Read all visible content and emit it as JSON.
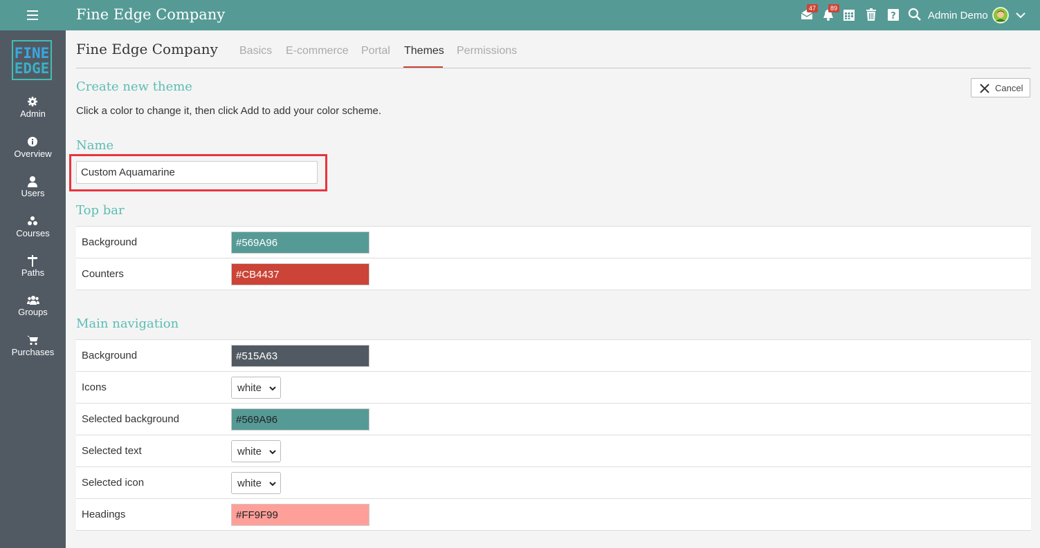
{
  "topbar": {
    "brand": "Fine Edge Company",
    "messages_count": "47",
    "notifications_count": "89",
    "user_name": "Admin Demo"
  },
  "sidebar": {
    "logo_line1": "FINE",
    "logo_line2": "EDGE",
    "items": [
      {
        "label": "Admin",
        "icon": "gear-icon"
      },
      {
        "label": "Overview",
        "icon": "info-icon"
      },
      {
        "label": "Users",
        "icon": "user-icon"
      },
      {
        "label": "Courses",
        "icon": "courses-icon"
      },
      {
        "label": "Paths",
        "icon": "signpost-icon"
      },
      {
        "label": "Groups",
        "icon": "group-icon"
      },
      {
        "label": "Purchases",
        "icon": "cart-icon"
      }
    ]
  },
  "header": {
    "title": "Fine Edge Company",
    "tabs": [
      "Basics",
      "E-commerce",
      "Portal",
      "Themes",
      "Permissions"
    ],
    "active_tab": "Themes"
  },
  "theme_form": {
    "heading": "Create new theme",
    "description": "Click a color to change it, then click Add to add your color scheme.",
    "cancel_label": "Cancel",
    "name_label": "Name",
    "name_value": "Custom Aquamarine",
    "top_bar_heading": "Top bar",
    "top_bar_rows": [
      {
        "label": "Background",
        "value": "#569A96",
        "color": "#569A96"
      },
      {
        "label": "Counters",
        "value": "#CB4437",
        "color": "#CB4437"
      }
    ],
    "main_nav_heading": "Main navigation",
    "main_nav_rows": [
      {
        "label": "Background",
        "value": "#515A63",
        "color": "#515A63"
      },
      {
        "label": "Icons",
        "value": "white"
      },
      {
        "label": "Selected background",
        "value": "#569A96",
        "color": "#569A96"
      },
      {
        "label": "Selected text",
        "value": "white"
      },
      {
        "label": "Selected icon",
        "value": "white"
      },
      {
        "label": "Headings",
        "value": "#FF9F99",
        "color": "#FF9F99"
      }
    ]
  }
}
